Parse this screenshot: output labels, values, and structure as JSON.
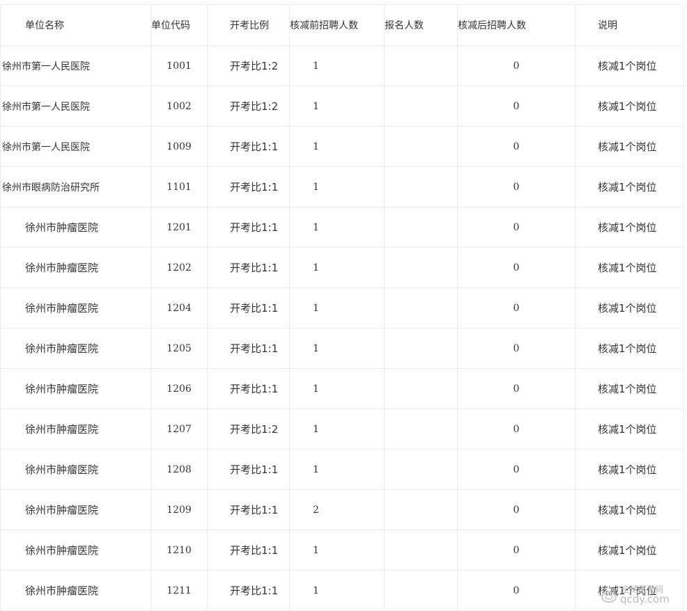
{
  "columns": [
    "单位名称",
    "单位代码",
    "开考比例",
    "核减前招聘人数",
    "报名人数",
    "核减后招聘人数",
    "说明"
  ],
  "rows": [
    {
      "name": "徐州市第一人民医院",
      "code": "1001",
      "ratio": "开考比1:2",
      "before": "1",
      "applicants": "",
      "after": "0",
      "note": "核减1个岗位"
    },
    {
      "name": "徐州市第一人民医院",
      "code": "1002",
      "ratio": "开考比1:2",
      "before": "1",
      "applicants": "",
      "after": "0",
      "note": "核减1个岗位"
    },
    {
      "name": "徐州市第一人民医院",
      "code": "1009",
      "ratio": "开考比1:1",
      "before": "1",
      "applicants": "",
      "after": "0",
      "note": "核减1个岗位"
    },
    {
      "name": "徐州市眼病防治研究所",
      "code": "1101",
      "ratio": "开考比1:1",
      "before": "1",
      "applicants": "",
      "after": "0",
      "note": "核减1个岗位"
    },
    {
      "name": "徐州市肿瘤医院",
      "code": "1201",
      "ratio": "开考比1:1",
      "before": "1",
      "applicants": "",
      "after": "0",
      "note": "核减1个岗位"
    },
    {
      "name": "徐州市肿瘤医院",
      "code": "1202",
      "ratio": "开考比1:1",
      "before": "1",
      "applicants": "",
      "after": "0",
      "note": "核减1个岗位"
    },
    {
      "name": "徐州市肿瘤医院",
      "code": "1204",
      "ratio": "开考比1:1",
      "before": "1",
      "applicants": "",
      "after": "0",
      "note": "核减1个岗位"
    },
    {
      "name": "徐州市肿瘤医院",
      "code": "1205",
      "ratio": "开考比1:1",
      "before": "1",
      "applicants": "",
      "after": "0",
      "note": "核减1个岗位"
    },
    {
      "name": "徐州市肿瘤医院",
      "code": "1206",
      "ratio": "开考比1:1",
      "before": "1",
      "applicants": "",
      "after": "0",
      "note": "核减1个岗位"
    },
    {
      "name": "徐州市肿瘤医院",
      "code": "1207",
      "ratio": "开考比1:2",
      "before": "1",
      "applicants": "",
      "after": "0",
      "note": "核减1个岗位"
    },
    {
      "name": "徐州市肿瘤医院",
      "code": "1208",
      "ratio": "开考比1:1",
      "before": "1",
      "applicants": "",
      "after": "0",
      "note": "核减1个岗位"
    },
    {
      "name": "徐州市肿瘤医院",
      "code": "1209",
      "ratio": "开考比1:1",
      "before": "2",
      "applicants": "",
      "after": "0",
      "note": "核减1个岗位"
    },
    {
      "name": "徐州市肿瘤医院",
      "code": "1210",
      "ratio": "开考比1:1",
      "before": "1",
      "applicants": "",
      "after": "0",
      "note": "核减1个岗位"
    },
    {
      "name": "徐州市肿瘤医院",
      "code": "1211",
      "ratio": "开考比1:1",
      "before": "1",
      "applicants": "",
      "after": "0",
      "note": "核减1个岗位"
    }
  ],
  "watermark": {
    "line1": "全球医考网",
    "line2": "qcdy.com"
  }
}
